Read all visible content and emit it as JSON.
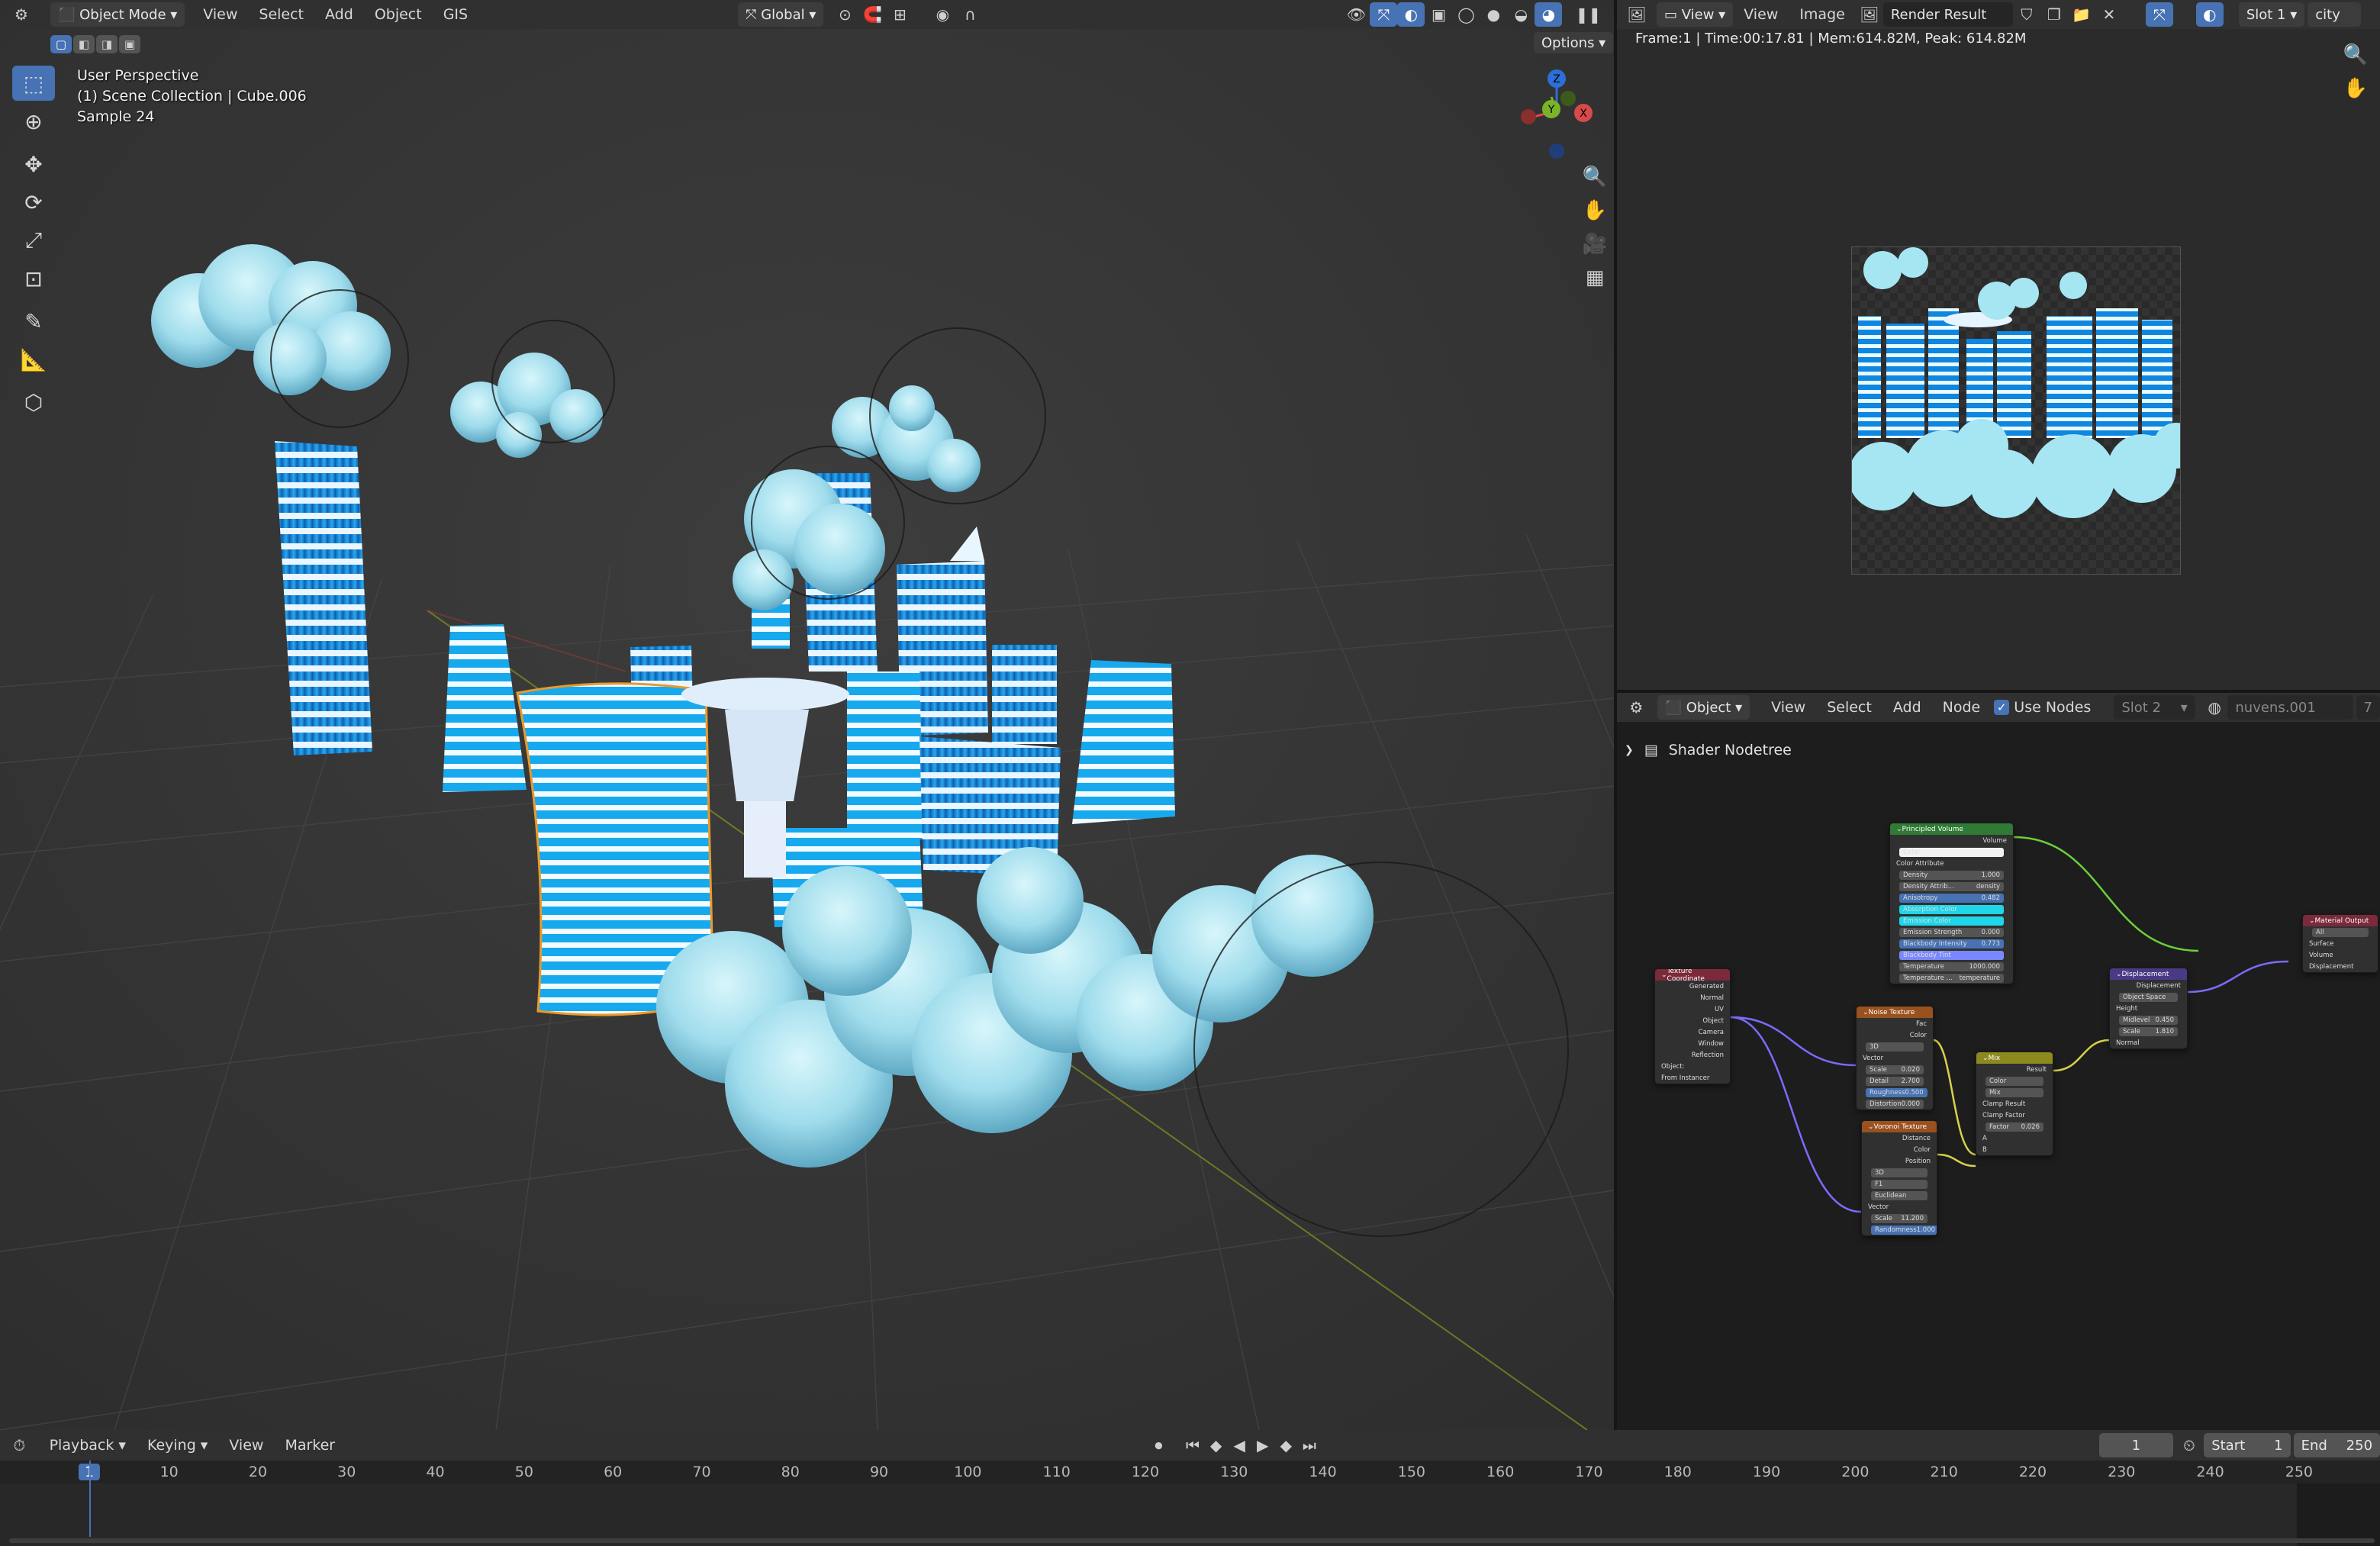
{
  "viewport": {
    "header": {
      "mode": "Object Mode",
      "menus": [
        "View",
        "Select",
        "Add",
        "Object",
        "GIS"
      ],
      "orientation": "Global",
      "options": "Options"
    },
    "overlay": {
      "line1": "User Perspective",
      "line2": "(1) Scene Collection | Cube.006",
      "line3": "Sample 24"
    },
    "tools": [
      "select-box",
      "cursor",
      "move",
      "rotate",
      "scale",
      "transform",
      "annotate",
      "measure",
      "add-cube"
    ],
    "gizmo": {
      "z": "Z",
      "y": "Y",
      "x": "X"
    }
  },
  "image_editor": {
    "menus": [
      "View",
      "View",
      "Image"
    ],
    "image_name": "Render Result",
    "slot": "Slot 1",
    "view_layer": "city",
    "info": "Frame:1 | Time:00:17.81 | Mem:614.82M, Peak: 614.82M"
  },
  "node_editor": {
    "object": "Object",
    "menus": [
      "View",
      "Select",
      "Add",
      "Node"
    ],
    "use_nodes": "Use Nodes",
    "slot": "Slot 2",
    "material": "nuvens.001",
    "users": "7",
    "breadcrumb": "Shader Nodetree",
    "nodes": {
      "principled": {
        "title": "Principled Volume",
        "out": "Volume",
        "rows": [
          "Color",
          "Color Attribute",
          "Density",
          "Density Attrib...",
          "Anisotropy",
          "Absorption Color",
          "Emission Color",
          "Emission Strength",
          "Blackbody Intensity",
          "Blackbody Tint",
          "Temperature",
          "Temperature ..."
        ],
        "vals": [
          "",
          "",
          "1.000",
          "density",
          "0.482",
          "",
          "",
          "0.000",
          "0.773",
          "",
          "1000.000",
          "temperature"
        ]
      },
      "material_output": {
        "title": "Material Output",
        "opt": "All",
        "rows": [
          "Surface",
          "Volume",
          "Displacement"
        ]
      },
      "texcoord": {
        "title": "Texture Coordinate",
        "rows": [
          "Generated",
          "Normal",
          "UV",
          "Object",
          "Camera",
          "Window",
          "Reflection"
        ],
        "object_label": "Object:",
        "from_instancer": "From Instancer"
      },
      "noise": {
        "title": "Noise Texture",
        "outs": [
          "Fac",
          "Color"
        ],
        "dim": "3D",
        "rows": [
          "Vector",
          "Scale",
          "Detail",
          "Roughness",
          "Distortion"
        ],
        "vals": [
          "",
          "0.020",
          "2.700",
          "0.500",
          "0.000"
        ]
      },
      "voronoi": {
        "title": "Voronoi Texture",
        "outs": [
          "Distance",
          "Color",
          "Position"
        ],
        "opts": [
          "3D",
          "F1",
          "Euclidean"
        ],
        "rows": [
          "Vector",
          "Scale",
          "Randomness"
        ],
        "vals": [
          "",
          "11.200",
          "1.000"
        ]
      },
      "mix": {
        "title": "Mix",
        "out": "Result",
        "opts": [
          "Color",
          "Mix"
        ],
        "checks": [
          "Clamp Result",
          "Clamp Factor"
        ],
        "factor_label": "Factor",
        "factor": "0.026",
        "rows": [
          "A",
          "B"
        ]
      },
      "displacement": {
        "title": "Displacement",
        "out": "Displacement",
        "space": "Object Space",
        "rows": [
          "Height",
          "Midlevel",
          "Scale",
          "Normal"
        ],
        "vals": [
          "",
          "0.450",
          "1.810",
          ""
        ]
      }
    }
  },
  "timeline": {
    "menus": [
      "Playback",
      "Keying",
      "View",
      "Marker"
    ],
    "current_frame": "1",
    "start_label": "Start",
    "start": "1",
    "end_label": "End",
    "end": "250",
    "ticks": [
      "1",
      "10",
      "20",
      "30",
      "40",
      "50",
      "60",
      "70",
      "80",
      "90",
      "100",
      "110",
      "120",
      "130",
      "140",
      "150",
      "160",
      "170",
      "180",
      "190",
      "200",
      "210",
      "220",
      "230",
      "240",
      "250"
    ]
  },
  "colors": {
    "accent": "#4772b3",
    "bg": "#1d1d1d",
    "header": "#303030",
    "building": "#1c8fe0",
    "cloud": "#a8e6f2",
    "node_shader": "#2f7a34",
    "node_texture": "#99511f",
    "node_input": "#7a2a3a",
    "node_vector": "#4a3a86",
    "node_color": "#8c8a1f",
    "node_output": "#7a2a3a"
  }
}
